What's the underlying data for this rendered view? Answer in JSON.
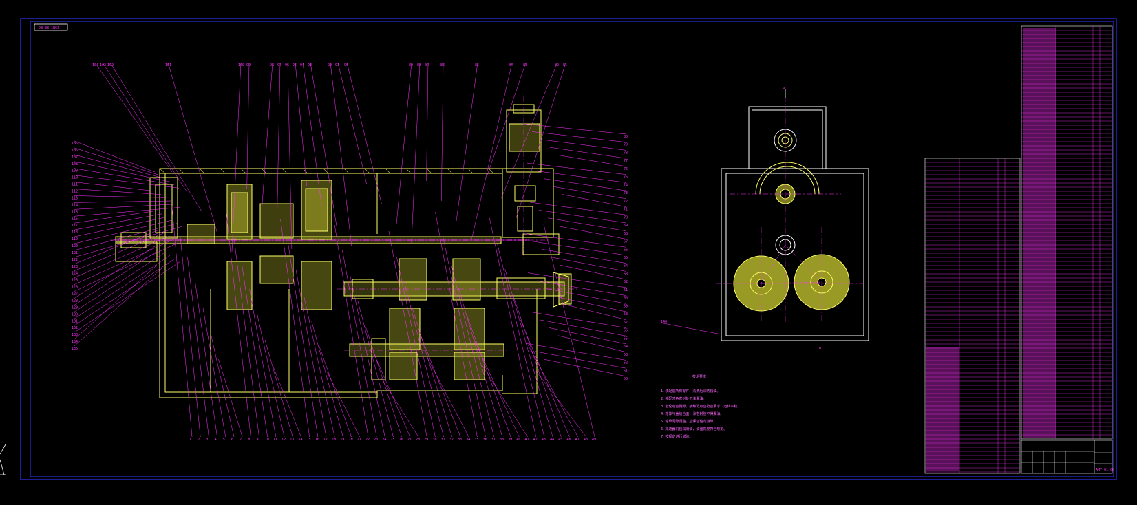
{
  "colors": {
    "background": "#000000",
    "frame": "#3333ff",
    "leader": "#ff33ff",
    "outline": "#ffff66",
    "hatch": "#cccc33",
    "white": "#ffffff"
  },
  "drawing": {
    "code_box": "DB-88-1W63",
    "tech_requirements_title": "技术要求",
    "tech_requirements": [
      "1. 装配前所有零件，清洗后涂防锈油。",
      "2. 装配时各密封处不准漏油。",
      "3. 齿轮啮合侧隙，接触斑点应符合要求，运转平稳。",
      "4. 箱体与盖结合面，涂密封胶不得漏油。",
      "5. 轴承间隙调整，应保证轴向游隙。",
      "6. 减速器内装润滑油，油面高度符合规定。",
      "7. 按规定进行试验。"
    ],
    "title_block_code": "AMT-01-00",
    "section_marks": [
      "A",
      "A"
    ]
  },
  "bottom_labels": [
    "1",
    "2",
    "3",
    "4",
    "5",
    "6",
    "7",
    "8",
    "9",
    "10",
    "11",
    "12",
    "13",
    "14",
    "15",
    "16",
    "17",
    "18",
    "19",
    "20",
    "21",
    "22",
    "23",
    "24",
    "25",
    "26",
    "27",
    "28",
    "29",
    "30",
    "31",
    "32",
    "33",
    "34",
    "35",
    "36",
    "37",
    "38",
    "39",
    "40",
    "41",
    "42",
    "43",
    "44",
    "45",
    "46",
    "47",
    "48",
    "49"
  ],
  "right_labels": [
    "80",
    "79",
    "78",
    "77",
    "76",
    "75",
    "74",
    "73",
    "72",
    "71",
    "70",
    "69",
    "68",
    "67",
    "66",
    "65",
    "64",
    "63",
    "62",
    "61",
    "60",
    "59",
    "58",
    "57",
    "56",
    "55",
    "54",
    "53",
    "52",
    "51",
    "50"
  ],
  "left_labels": [
    "105",
    "106",
    "107",
    "108",
    "109",
    "110",
    "111",
    "112",
    "113",
    "114",
    "115",
    "116",
    "117",
    "118",
    "119",
    "120",
    "121",
    "122",
    "123",
    "124",
    "125",
    "126",
    "127",
    "128",
    "129",
    "130",
    "131",
    "132",
    "133",
    "134",
    "135"
  ],
  "top_labels": [
    "104",
    "103",
    "102",
    "101",
    "100",
    "99",
    "98",
    "97",
    "96",
    "95",
    "94",
    "93",
    "92",
    "91",
    "90",
    "89",
    "88",
    "87",
    "86",
    "85",
    "84",
    "83",
    "82",
    "81"
  ]
}
